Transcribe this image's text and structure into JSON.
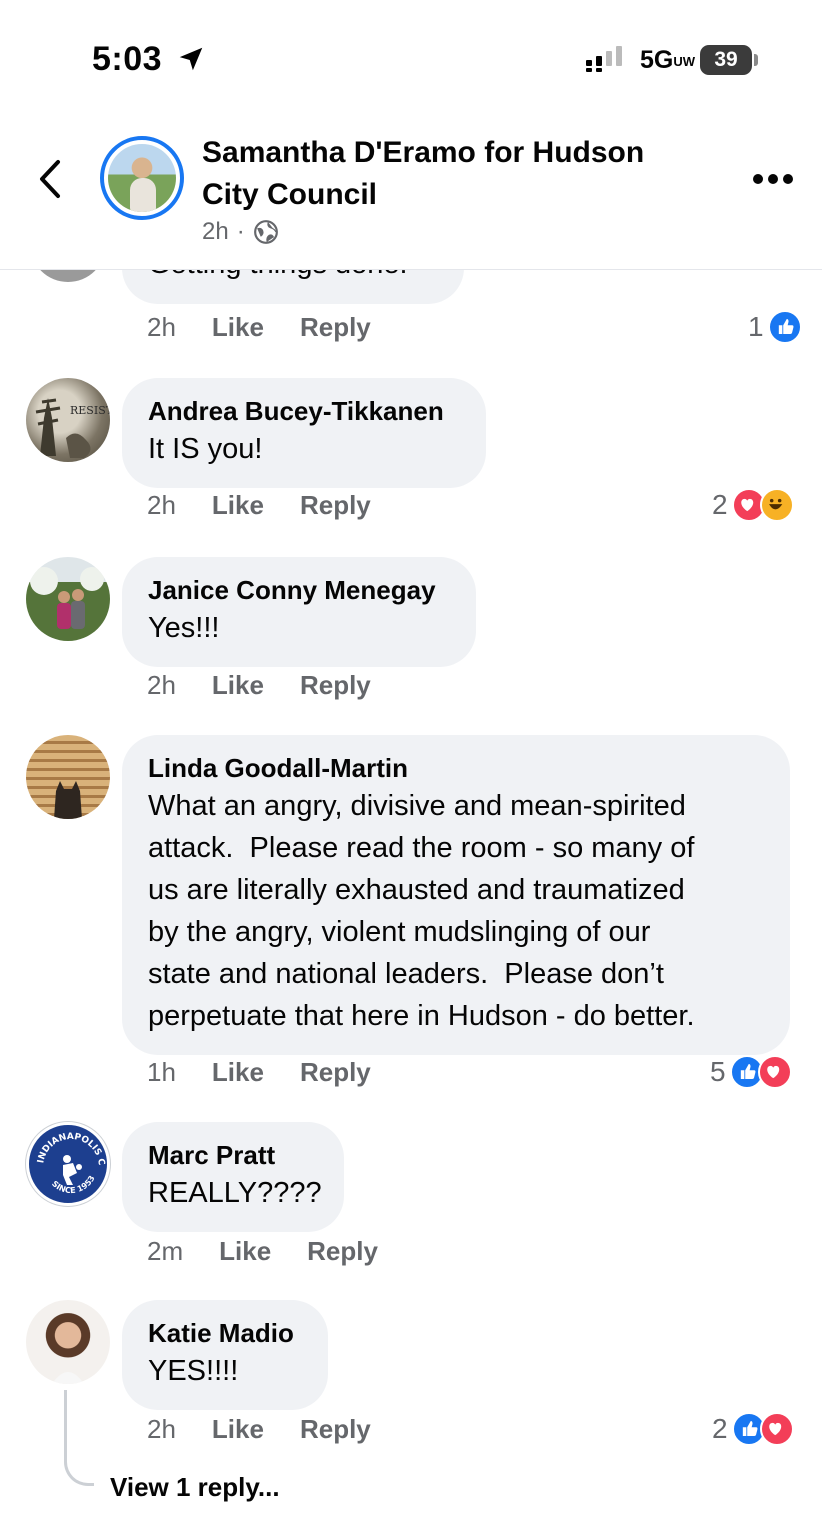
{
  "status_bar": {
    "time": "5:03",
    "network": "5G",
    "network_sub": "UW",
    "battery": "39"
  },
  "header": {
    "page_title": "Samantha D'Eramo for Hudson City Council",
    "post_time": "2h",
    "separator": "·"
  },
  "partial_comment": {
    "text": "Getting things done!",
    "time": "2h",
    "like_label": "Like",
    "reply_label": "Reply",
    "reaction_count": "1"
  },
  "comments": [
    {
      "author": "Andrea Bucey-Tikkanen",
      "text": "It IS you!",
      "time": "2h",
      "like_label": "Like",
      "reply_label": "Reply",
      "reaction_count": "2",
      "avatar_text": "RESIST"
    },
    {
      "author": "Janice Conny Menegay",
      "text": "Yes!!!",
      "time": "2h",
      "like_label": "Like",
      "reply_label": "Reply"
    },
    {
      "author": "Linda Goodall-Martin",
      "text": "What an angry, divisive and mean-spirited\nattack.  Please read the room - so many of\nus are literally exhausted and traumatized\nby the angry, violent mudslinging of our\nstate and national leaders.  Please don’t\nperpetuate that here in Hudson - do better.",
      "time": "1h",
      "like_label": "Like",
      "reply_label": "Reply",
      "reaction_count": "5"
    },
    {
      "author": "Marc Pratt",
      "text": "REALLY????",
      "time": "2m",
      "like_label": "Like",
      "reply_label": "Reply",
      "avatar_text_top": "INDIANAPOLIS COLTS",
      "avatar_text_bottom": "SINCE 1953"
    },
    {
      "author": "Katie Madio",
      "text": "YES!!!!",
      "time": "2h",
      "like_label": "Like",
      "reply_label": "Reply",
      "reaction_count": "2"
    }
  ],
  "view_replies": "View 1 reply...",
  "colors": {
    "facebook_blue": "#1877f2",
    "love_red": "#f33e58",
    "haha_yellow": "#f7b125",
    "bubble_gray": "#f0f2f5",
    "meta_gray": "#65676b"
  }
}
